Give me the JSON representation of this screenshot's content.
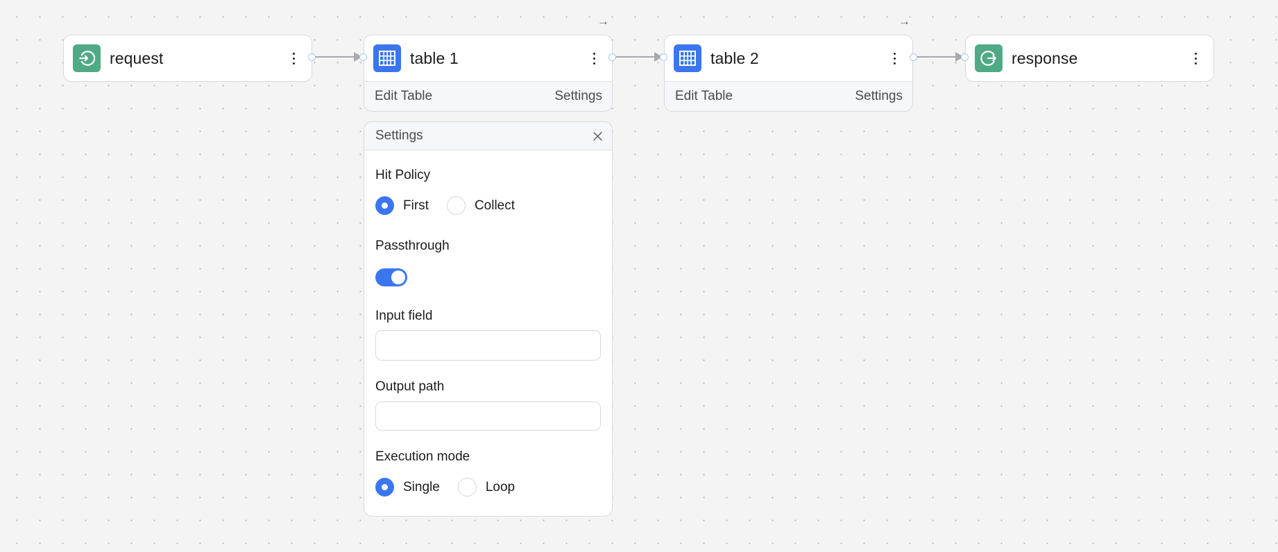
{
  "canvas": {
    "background": "#f4f4f4",
    "accent_blue": "#3b76f0",
    "accent_green": "#4faa85"
  },
  "nodes": [
    {
      "id": "request",
      "title": "request",
      "icon": "log-in-icon",
      "icon_color": "#4faa85",
      "has_footer": false
    },
    {
      "id": "table1",
      "title": "table 1",
      "icon": "table-icon",
      "icon_color": "#3b76f0",
      "has_footer": true,
      "footer": {
        "left": "Edit Table",
        "right": "Settings"
      }
    },
    {
      "id": "table2",
      "title": "table 2",
      "icon": "table-icon",
      "icon_color": "#3b76f0",
      "has_footer": true,
      "footer": {
        "left": "Edit Table",
        "right": "Settings"
      }
    },
    {
      "id": "response",
      "title": "response",
      "icon": "log-out-icon",
      "icon_color": "#4faa85",
      "has_footer": false
    }
  ],
  "edges": [
    {
      "from": "request",
      "to": "table1"
    },
    {
      "from": "table1",
      "to": "table2"
    },
    {
      "from": "table2",
      "to": "response"
    }
  ],
  "top_arrows": [
    "→",
    "→"
  ],
  "settings_panel": {
    "title": "Settings",
    "hit_policy": {
      "label": "Hit Policy",
      "options": [
        "First",
        "Collect"
      ],
      "selected": "First"
    },
    "passthrough": {
      "label": "Passthrough",
      "enabled": true
    },
    "input_field": {
      "label": "Input field",
      "value": "",
      "placeholder": ""
    },
    "output_path": {
      "label": "Output path",
      "value": "",
      "placeholder": ""
    },
    "execution_mode": {
      "label": "Execution mode",
      "options": [
        "Single",
        "Loop"
      ],
      "selected": "Single"
    }
  }
}
